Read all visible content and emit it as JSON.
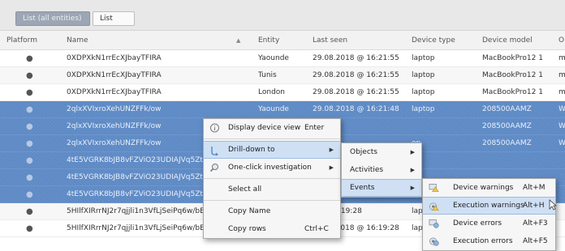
{
  "toolbar": {
    "tab_active_label": "List (all entities)",
    "tab_list_label": "List"
  },
  "table": {
    "columns": [
      "Platform",
      "Name",
      "Entity",
      "Last seen",
      "Device type",
      "Device model",
      "O"
    ],
    "sort_indicator": "▲",
    "platform_icon": "apple-icon",
    "rows": [
      {
        "name": "0XDPXkN1rrEcXJbayTFIRA",
        "entity": "Yaounde",
        "last_seen": "29.08.2018 @ 16:21:55",
        "device_type": "laptop",
        "device_model": "MacBookPro12 1",
        "extra": "m",
        "selected": false
      },
      {
        "name": "0XDPXkN1rrEcXJbayTFIRA",
        "entity": "Tunis",
        "last_seen": "29.08.2018 @ 16:21:55",
        "device_type": "laptop",
        "device_model": "MacBookPro12 1",
        "extra": "m",
        "selected": false
      },
      {
        "name": "0XDPXkN1rrEcXJbayTFIRA",
        "entity": "London",
        "last_seen": "29.08.2018 @ 16:21:55",
        "device_type": "laptop",
        "device_model": "MacBookPro12 1",
        "extra": "m",
        "selected": false
      },
      {
        "name": "2qlxXVIxroXehUNZFFk/ow",
        "entity": "Yaounde",
        "last_seen": "29.08.2018 @ 16:21:48",
        "device_type": "laptop",
        "device_model": "208500AAMZ",
        "extra": "W",
        "selected": true
      },
      {
        "name": "2qlxXVIxroXehUNZFFk/ow",
        "entity": "",
        "last_seen": "",
        "device_type": "",
        "device_model": "208500AAMZ",
        "extra": "W",
        "selected": true
      },
      {
        "name": "2qlxXVIxroXehUNZFFk/ow",
        "entity": "",
        "last_seen": "",
        "device_type": "op",
        "device_model": "208500AAMZ",
        "extra": "W",
        "selected": true
      },
      {
        "name": "4tE5VGRK8bJB8vFZViO23UDIAJVq5Ztb5",
        "entity": "",
        "last_seen": "",
        "device_type": "",
        "device_model": "",
        "extra": "",
        "selected": true
      },
      {
        "name": "4tE5VGRK8bJB8vFZViO23UDIAJVq5Ztb5",
        "entity": "",
        "last_seen": "",
        "device_type": "",
        "device_model": "",
        "extra": "",
        "selected": true
      },
      {
        "name": "4tE5VGRK8bJB8vFZViO23UDIAJVq5Ztb5",
        "entity": "",
        "last_seen": "8 @ 16:21:53",
        "device_type": "lapt",
        "device_model": "",
        "extra": "",
        "selected": true
      },
      {
        "name": "5HIlfXIRrrNJ2r7qjjli1n3VfLjSeiPq6w/bE",
        "entity": "",
        "last_seen": "8 @ 16:19:28",
        "device_type": "lapt",
        "device_model": "",
        "extra": "",
        "selected": false
      },
      {
        "name": "5HIlfXIRrrNJ2r7qjjli1n3VfLjSeiPq6w/bEL cRvHRQ",
        "entity": "Tunis",
        "last_seen": "29.08.2018 @ 16:19:28",
        "device_type": "laptop",
        "device_model": "MacBookPro12 1",
        "extra": "",
        "selected": false
      }
    ]
  },
  "context_menu": {
    "items": [
      {
        "label": "Display device view",
        "shortcut": "Enter",
        "icon": "info-icon",
        "submenu": false
      },
      {
        "label": "Drill-down to",
        "shortcut": "",
        "icon": "drill-down-icon",
        "submenu": true,
        "active": true
      },
      {
        "label": "One-click investigation",
        "shortcut": "",
        "icon": "magnifier-icon",
        "submenu": true
      },
      {
        "label": "Select all",
        "shortcut": "",
        "icon": "",
        "submenu": false
      },
      {
        "label": "Copy Name",
        "shortcut": "",
        "icon": "",
        "submenu": false
      },
      {
        "label": "Copy rows",
        "shortcut": "Ctrl+C",
        "icon": "",
        "submenu": false
      }
    ]
  },
  "drill_menu": {
    "items": [
      {
        "label": "Objects",
        "submenu": true
      },
      {
        "label": "Activities",
        "submenu": true
      },
      {
        "label": "Events",
        "submenu": true,
        "active": true
      }
    ]
  },
  "events_menu": {
    "items": [
      {
        "label": "Device warnings",
        "shortcut": "Alt+M",
        "icon": "device-warnings-icon"
      },
      {
        "label": "Execution warnings",
        "shortcut": "Alt+H",
        "icon": "execution-warnings-icon",
        "active": true
      },
      {
        "label": "Device errors",
        "shortcut": "Alt+F3",
        "icon": "device-errors-icon"
      },
      {
        "label": "Execution errors",
        "shortcut": "Alt+F5",
        "icon": "execution-errors-icon"
      }
    ]
  },
  "colors": {
    "selection": "#5e8ac5",
    "menu_highlight": "#cfe0f5",
    "toolbar": "#e8e8e8"
  }
}
